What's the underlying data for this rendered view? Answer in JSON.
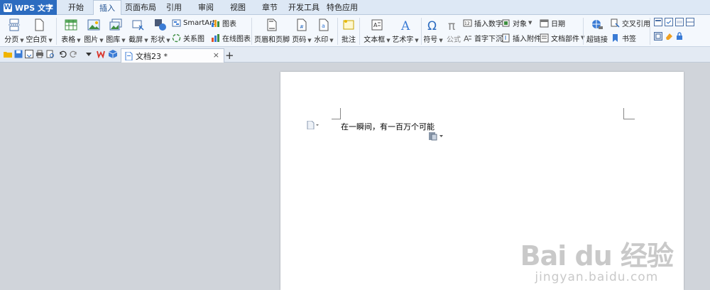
{
  "app": {
    "name": "WPS 文字"
  },
  "menu": {
    "tabs": [
      "开始",
      "插入",
      "页面布局",
      "引用",
      "审阅",
      "视图",
      "章节",
      "开发工具",
      "特色应用"
    ],
    "active_tab": "插入"
  },
  "ribbon": {
    "page_break": "分页",
    "blank_page": "空白页",
    "table": "表格",
    "picture": "图片",
    "gallery": "图库",
    "screenshot": "截屏",
    "shape": "形状",
    "smartart": "SmartArt",
    "chart": "图表",
    "relation_chart": "关系图",
    "online_chart": "在线图表",
    "header_footer": "页眉和页脚",
    "page_number": "页码",
    "watermark": "水印",
    "comment": "批注",
    "text_box": "文本框",
    "word_art": "艺术字",
    "symbol": "符号",
    "formula": "公式",
    "insert_number": "插入数字",
    "object": "对象",
    "drop_cap": "首字下沉",
    "insert_attachment": "插入附件",
    "date": "日期",
    "doc_parts": "文档部件",
    "hyperlink": "超链接",
    "cross_reference": "交叉引用",
    "bookmark": "书签"
  },
  "tabs_bar": {
    "doc_tab": "文档23 *",
    "close": "×",
    "add": "+"
  },
  "document": {
    "text": "在一瞬间，有一百万个可能"
  },
  "watermark": {
    "brand": "Bai du 经验",
    "url": "jingyan.baidu.com"
  },
  "colors": {
    "accent": "#2c6cc0",
    "ribbon_bg": "#f4f8fd",
    "workspace_bg": "#d0d4da"
  }
}
